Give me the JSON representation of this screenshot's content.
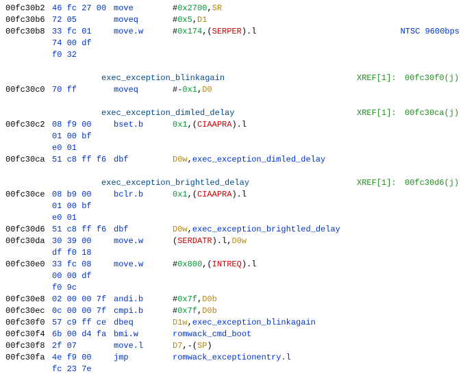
{
  "rows": [
    {
      "addr": "00fc30b2",
      "bytes": "46 fc 27 00",
      "mnem": "move",
      "ops": [
        {
          "t": "#",
          "k": "p"
        },
        {
          "t": "0x2700",
          "k": "hex"
        },
        {
          "t": ",",
          "k": "p"
        },
        {
          "t": "SR",
          "k": "reg"
        }
      ]
    },
    {
      "addr": "00fc30b6",
      "bytes": "72 05",
      "mnem": "moveq",
      "ops": [
        {
          "t": "#",
          "k": "p"
        },
        {
          "t": "0x5",
          "k": "hex"
        },
        {
          "t": ",",
          "k": "p"
        },
        {
          "t": "D1",
          "k": "reg"
        }
      ]
    },
    {
      "addr": "00fc30b8",
      "bytes": "33 fc 01",
      "mnem": "move.w",
      "ops": [
        {
          "t": "#",
          "k": "p"
        },
        {
          "t": "0x174",
          "k": "hex"
        },
        {
          "t": ",(",
          "k": "p"
        },
        {
          "t": "SERPER",
          "k": "sym"
        },
        {
          "t": ").l",
          "k": "p"
        }
      ],
      "note": "NTSC 9600bps"
    },
    {
      "addr": "",
      "bytes": "74 00 df"
    },
    {
      "addr": "",
      "bytes": "f0 32"
    },
    {
      "blank": true
    },
    {
      "label": "exec_exception_blinkagain",
      "xref": "XREF[1]:",
      "xtgt": "00fc30f0(j)"
    },
    {
      "addr": "00fc30c0",
      "bytes": "70 ff",
      "mnem": "moveq",
      "ops": [
        {
          "t": "#-",
          "k": "p"
        },
        {
          "t": "0x1",
          "k": "hex"
        },
        {
          "t": ",",
          "k": "p"
        },
        {
          "t": "D0",
          "k": "reg"
        }
      ]
    },
    {
      "blank": true
    },
    {
      "label": "exec_exception_dimled_delay",
      "xref": "XREF[1]:",
      "xtgt": "00fc30ca(j)"
    },
    {
      "addr": "00fc30c2",
      "bytes": "08 f9 00",
      "mnem": "bset.b",
      "ops": [
        {
          "t": "0x1",
          "k": "hex"
        },
        {
          "t": ",(",
          "k": "p"
        },
        {
          "t": "CIAAPRA",
          "k": "sym"
        },
        {
          "t": ").l",
          "k": "p"
        }
      ]
    },
    {
      "addr": "",
      "bytes": "01 00 bf"
    },
    {
      "addr": "",
      "bytes": "e0 01"
    },
    {
      "addr": "00fc30ca",
      "bytes": "51 c8 ff f6",
      "mnem": "dbf",
      "ops": [
        {
          "t": "D0w",
          "k": "reg"
        },
        {
          "t": ",",
          "k": "p"
        },
        {
          "t": "exec_exception_dimled_delay",
          "k": "blue"
        }
      ]
    },
    {
      "blank": true
    },
    {
      "label": "exec_exception_brightled_delay",
      "xref": "XREF[1]:",
      "xtgt": "00fc30d6(j)"
    },
    {
      "addr": "00fc30ce",
      "bytes": "08 b9 00",
      "mnem": "bclr.b",
      "ops": [
        {
          "t": "0x1",
          "k": "hex"
        },
        {
          "t": ",(",
          "k": "p"
        },
        {
          "t": "CIAAPRA",
          "k": "sym"
        },
        {
          "t": ").l",
          "k": "p"
        }
      ]
    },
    {
      "addr": "",
      "bytes": "01 00 bf"
    },
    {
      "addr": "",
      "bytes": "e0 01"
    },
    {
      "addr": "00fc30d6",
      "bytes": "51 c8 ff f6",
      "mnem": "dbf",
      "ops": [
        {
          "t": "D0w",
          "k": "reg"
        },
        {
          "t": ",",
          "k": "p"
        },
        {
          "t": "exec_exception_brightled_delay",
          "k": "blue"
        }
      ]
    },
    {
      "addr": "00fc30da",
      "bytes": "30 39 00",
      "mnem": "move.w",
      "ops": [
        {
          "t": "(",
          "k": "p"
        },
        {
          "t": "SERDATR",
          "k": "sym"
        },
        {
          "t": ").l,",
          "k": "p"
        },
        {
          "t": "D0w",
          "k": "reg"
        }
      ]
    },
    {
      "addr": "",
      "bytes": "df f0 18"
    },
    {
      "addr": "00fc30e0",
      "bytes": "33 fc 08",
      "mnem": "move.w",
      "ops": [
        {
          "t": "#",
          "k": "p"
        },
        {
          "t": "0x800",
          "k": "hex"
        },
        {
          "t": ",(",
          "k": "p"
        },
        {
          "t": "INTREQ",
          "k": "sym"
        },
        {
          "t": ").l",
          "k": "p"
        }
      ]
    },
    {
      "addr": "",
      "bytes": "00 00 df"
    },
    {
      "addr": "",
      "bytes": "f0 9c"
    },
    {
      "addr": "00fc30e8",
      "bytes": "02 00 00 7f",
      "mnem": "andi.b",
      "ops": [
        {
          "t": "#",
          "k": "p"
        },
        {
          "t": "0x7f",
          "k": "hex"
        },
        {
          "t": ",",
          "k": "p"
        },
        {
          "t": "D0b",
          "k": "reg"
        }
      ]
    },
    {
      "addr": "00fc30ec",
      "bytes": "0c 00 00 7f",
      "mnem": "cmpi.b",
      "ops": [
        {
          "t": "#",
          "k": "p"
        },
        {
          "t": "0x7f",
          "k": "hex"
        },
        {
          "t": ",",
          "k": "p"
        },
        {
          "t": "D0b",
          "k": "reg"
        }
      ]
    },
    {
      "addr": "00fc30f0",
      "bytes": "57 c9 ff ce",
      "mnem": "dbeq",
      "ops": [
        {
          "t": "D1w",
          "k": "reg"
        },
        {
          "t": ",",
          "k": "p"
        },
        {
          "t": "exec_exception_blinkagain",
          "k": "blue"
        }
      ]
    },
    {
      "addr": "00fc30f4",
      "bytes": "6b 00 d4 fa",
      "mnem": "bmi.w",
      "ops": [
        {
          "t": "romwack_cmd_boot",
          "k": "blue"
        }
      ]
    },
    {
      "addr": "00fc30f8",
      "bytes": "2f 07",
      "mnem": "move.l",
      "ops": [
        {
          "t": "D7",
          "k": "reg"
        },
        {
          "t": ",-(",
          "k": "p"
        },
        {
          "t": "SP",
          "k": "reg"
        },
        {
          "t": ")",
          "k": "p"
        }
      ]
    },
    {
      "addr": "00fc30fa",
      "bytes": "4e f9 00",
      "mnem": "jmp",
      "ops": [
        {
          "t": "romwack_exceptionentry.l",
          "k": "blue"
        }
      ]
    },
    {
      "addr": "",
      "bytes": "fc 23 7e"
    }
  ]
}
